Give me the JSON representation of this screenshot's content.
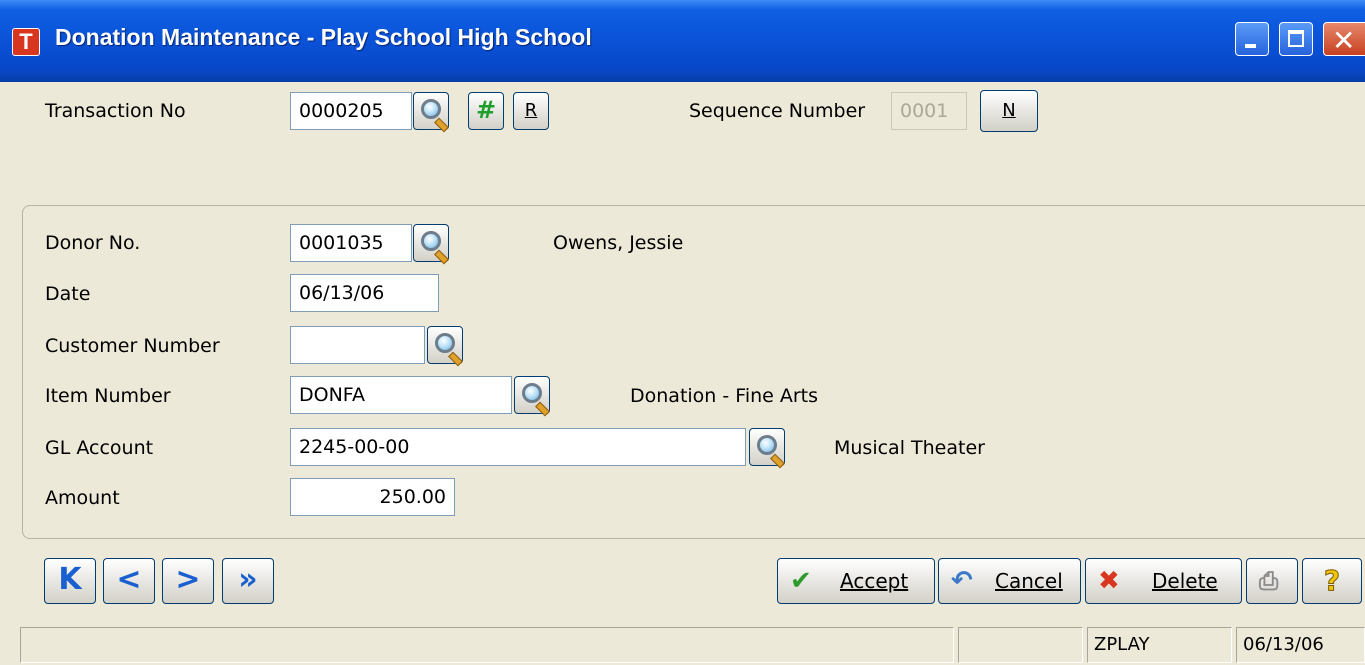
{
  "window": {
    "title": "Donation Maintenance - Play School High School",
    "app_icon_letter": "T"
  },
  "header": {
    "transaction_label": "Transaction No",
    "transaction_value": "0000205",
    "hash_glyph": "#",
    "r_button_label": "R",
    "sequence_label": "Sequence Number",
    "sequence_value": "0001",
    "n_button_label": "N"
  },
  "form": {
    "donor_label": "Donor No.",
    "donor_value": "0001035",
    "donor_name": "Owens, Jessie",
    "date_label": "Date",
    "date_value": "06/13/06",
    "customer_label": "Customer Number",
    "customer_value": "",
    "item_label": "Item Number",
    "item_value": "DONFA",
    "item_desc": "Donation - Fine Arts",
    "gl_label": "GL Account",
    "gl_value": "2245-00-00",
    "gl_desc": "Musical Theater",
    "amount_label": "Amount",
    "amount_value": "250.00"
  },
  "nav": {
    "first": "K",
    "prev": "<",
    "next": ">",
    "last": "»"
  },
  "actions": {
    "accept_label": "Accept",
    "cancel_label": "Cancel",
    "delete_label": "Delete",
    "help_glyph": "?"
  },
  "status": {
    "company": "ZPLAY",
    "date": "06/13/06"
  },
  "colors": {
    "titlebar": "#0a52d8",
    "window_bg": "#ece9d8",
    "accept_check": "#2e9a2e",
    "delete_x": "#d8361e",
    "help": "#f2c40f"
  }
}
